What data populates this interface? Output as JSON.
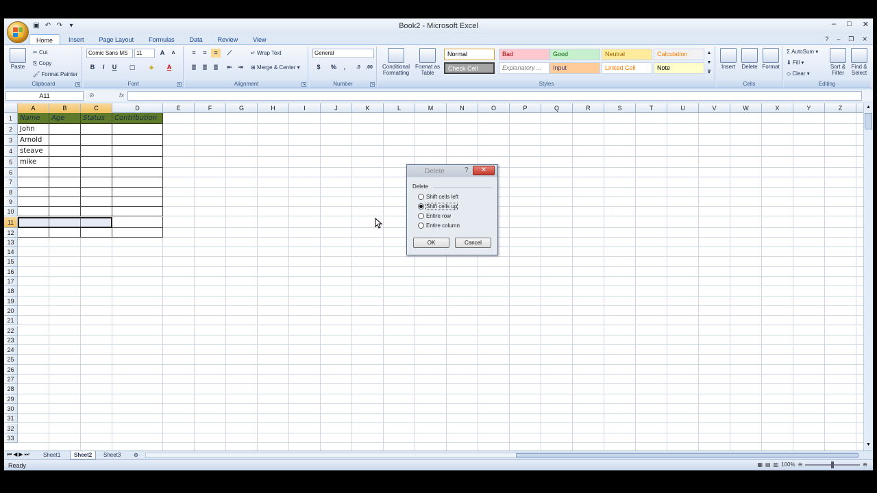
{
  "window": {
    "title": "Book2 - Microsoft Excel"
  },
  "tabs": [
    "Home",
    "Insert",
    "Page Layout",
    "Formulas",
    "Data",
    "Review",
    "View"
  ],
  "ribbon": {
    "clipboard": {
      "label": "Clipboard",
      "paste": "Paste",
      "cut": "Cut",
      "copy": "Copy",
      "format_painter": "Format Painter"
    },
    "font": {
      "label": "Font",
      "font_name": "Comic Sans MS",
      "font_size": "11",
      "bold": "B",
      "italic": "I",
      "underline": "U"
    },
    "alignment": {
      "label": "Alignment",
      "wrap_text": "Wrap Text",
      "merge_center": "Merge & Center"
    },
    "number": {
      "label": "Number",
      "format": "General",
      "currency": "$",
      "percent": "%",
      "comma": ","
    },
    "styles": {
      "label": "Styles",
      "conditional": "Conditional Formatting",
      "format_table": "Format as Table",
      "cells": [
        {
          "name": "Normal",
          "bg": "#ffffff",
          "fg": "#000000"
        },
        {
          "name": "Bad",
          "bg": "#ffc7ce",
          "fg": "#9c0006"
        },
        {
          "name": "Good",
          "bg": "#c6efce",
          "fg": "#006100"
        },
        {
          "name": "Neutral",
          "bg": "#ffeb9c",
          "fg": "#9c6500"
        },
        {
          "name": "Calculation",
          "bg": "#f2f2f2",
          "fg": "#fa7d00"
        },
        {
          "name": "Check Cell",
          "bg": "#a5a5a5",
          "fg": "#ffffff"
        },
        {
          "name": "Explanatory ...",
          "bg": "#ffffff",
          "fg": "#7f7f7f"
        },
        {
          "name": "Input",
          "bg": "#ffcc99",
          "fg": "#3f3f76"
        },
        {
          "name": "Linked Cell",
          "bg": "#ffffff",
          "fg": "#fa7d00"
        },
        {
          "name": "Note",
          "bg": "#ffffcc",
          "fg": "#000000"
        }
      ]
    },
    "cells": {
      "label": "Cells",
      "insert": "Insert",
      "delete": "Delete",
      "format": "Format"
    },
    "editing": {
      "label": "Editing",
      "autosum": "AutoSum",
      "fill": "Fill",
      "clear": "Clear",
      "sort_filter": "Sort & Filter",
      "find_select": "Find & Select"
    }
  },
  "formula_bar": {
    "name_box": "A11",
    "fx": "fx",
    "value": ""
  },
  "columns": [
    "A",
    "B",
    "C",
    "D",
    "E",
    "F",
    "G",
    "H",
    "I",
    "J",
    "K",
    "L",
    "M",
    "N",
    "O",
    "P",
    "Q",
    "R",
    "S",
    "T",
    "U",
    "V",
    "W",
    "X",
    "Y",
    "Z"
  ],
  "rows": [
    "1",
    "2",
    "3",
    "4",
    "5",
    "6",
    "7",
    "8",
    "9",
    "10",
    "11",
    "12",
    "13",
    "14",
    "15",
    "16",
    "17",
    "18",
    "19",
    "20",
    "21",
    "22",
    "23",
    "24",
    "25",
    "26",
    "27",
    "28",
    "29",
    "30",
    "31",
    "32",
    "33"
  ],
  "sheet": {
    "headers": [
      "Name",
      "Age",
      "Status",
      "Contribution"
    ],
    "names": [
      "John",
      "Arnold",
      "steave",
      "mike"
    ]
  },
  "sheet_tabs": [
    "Sheet1",
    "Sheet2",
    "Sheet3"
  ],
  "active_sheet": "Sheet2",
  "status": "Ready",
  "zoom": "100%",
  "dialog": {
    "title": "Delete",
    "help": "?",
    "close": "✕",
    "section": "Delete",
    "options": [
      {
        "label": "Shift cells left",
        "selected": false
      },
      {
        "label": "Shift cells up",
        "selected": true
      },
      {
        "label": "Entire row",
        "selected": false
      },
      {
        "label": "Entire column",
        "selected": false
      }
    ],
    "ok": "OK",
    "cancel": "Cancel"
  }
}
